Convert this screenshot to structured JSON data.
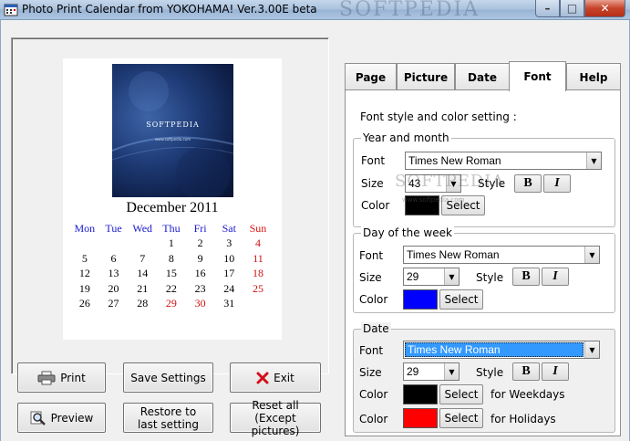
{
  "window": {
    "title": "Photo Print Calendar from YOKOHAMA! Ver.3.00E beta",
    "watermark": "SOFTPEDIA",
    "controls": {
      "minimize": "–",
      "maximize": "□",
      "close": "✕"
    }
  },
  "preview": {
    "photo_text": "SOFTPEDIA",
    "photo_subtext": "www.softpedia.com",
    "month_title": "December 2011",
    "weekdays": [
      "Mon",
      "Tue",
      "Wed",
      "Thu",
      "Fri",
      "Sat",
      "Sun"
    ],
    "weeks": [
      [
        "",
        "",
        "",
        "1",
        "2",
        "3",
        "4"
      ],
      [
        "5",
        "6",
        "7",
        "8",
        "9",
        "10",
        "11"
      ],
      [
        "12",
        "13",
        "14",
        "15",
        "16",
        "17",
        "18"
      ],
      [
        "19",
        "20",
        "21",
        "22",
        "23",
        "24",
        "25"
      ],
      [
        "26",
        "27",
        "28",
        "29",
        "30",
        "31",
        ""
      ]
    ],
    "holiday_dates": [
      "4",
      "11",
      "18",
      "25",
      "29",
      "30"
    ],
    "colors": {
      "weekday_header": "#1a1acc",
      "sunday_header": "#dd1111",
      "holiday": "#cc1111"
    }
  },
  "buttons": {
    "print": "Print",
    "save_settings": "Save Settings",
    "exit": "Exit",
    "preview": "Preview",
    "restore_line1": "Restore to",
    "restore_line2": "last setting",
    "reset_line1": "Reset all",
    "reset_line2": "(Except pictures)"
  },
  "tabs": [
    {
      "label": "Page"
    },
    {
      "label": "Picture"
    },
    {
      "label": "Date"
    },
    {
      "label": "Font",
      "active": true
    },
    {
      "label": "Help"
    }
  ],
  "font_tab": {
    "intro": "Font style and color setting :",
    "labels": {
      "font": "Font",
      "size": "Size",
      "style": "Style",
      "color": "Color",
      "select": "Select",
      "bold": "B",
      "italic": "I"
    },
    "year_month": {
      "title": "Year and month",
      "font": "Times New Roman",
      "size": "43",
      "color": "#000000"
    },
    "day_of_week": {
      "title": "Day of the week",
      "font": "Times New Roman",
      "size": "29",
      "color": "#0000ff"
    },
    "date": {
      "title": "Date",
      "font": "Times New Roman",
      "size": "29",
      "weekday_color": "#000000",
      "holiday_color": "#ff0000",
      "weekday_label": "for Weekdays",
      "holiday_label": "for Holidays"
    },
    "watermark": "SOFTPEDIA",
    "watermark_url": "www.softpedia.com"
  }
}
